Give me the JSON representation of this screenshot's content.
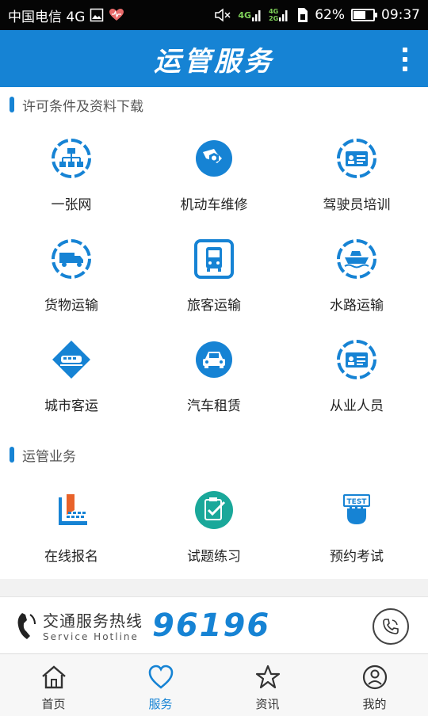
{
  "status_bar": {
    "carrier": "中国电信 4G",
    "net_4g": "4G",
    "net_4g_top": "4G",
    "net_2g": "2G",
    "battery": "62%",
    "battery_level": 0.62,
    "time": "09:37"
  },
  "app_bar": {
    "title": "运管服务"
  },
  "sections": [
    {
      "title": "许可条件及资料下载",
      "items": [
        {
          "label": "一张网",
          "icon": "network-icon"
        },
        {
          "label": "机动车维修",
          "icon": "wrench-icon"
        },
        {
          "label": "驾驶员培训",
          "icon": "id-card-icon"
        },
        {
          "label": "货物运输",
          "icon": "truck-icon"
        },
        {
          "label": "旅客运输",
          "icon": "bus-icon"
        },
        {
          "label": "水路运输",
          "icon": "ship-icon"
        },
        {
          "label": "城市客运",
          "icon": "train-icon"
        },
        {
          "label": "汽车租赁",
          "icon": "car-icon"
        },
        {
          "label": "从业人员",
          "icon": "staff-card-icon"
        }
      ]
    },
    {
      "title": "运管业务",
      "items": [
        {
          "label": "在线报名",
          "icon": "online-register-icon"
        },
        {
          "label": "试题练习",
          "icon": "exam-practice-icon"
        },
        {
          "label": "预约考试",
          "icon": "test-booking-icon"
        }
      ]
    }
  ],
  "hotline": {
    "title": "交通服务热线",
    "subtitle": "Service Hotline",
    "number": "96196"
  },
  "bottom_nav": [
    {
      "label": "首页",
      "icon": "home-icon",
      "active": false
    },
    {
      "label": "服务",
      "icon": "heart-icon",
      "active": true
    },
    {
      "label": "资讯",
      "icon": "star-icon",
      "active": false
    },
    {
      "label": "我的",
      "icon": "profile-icon",
      "active": false
    }
  ],
  "colors": {
    "accent": "#1683d4",
    "background": "#ffffff",
    "nav_inactive": "#333333"
  }
}
